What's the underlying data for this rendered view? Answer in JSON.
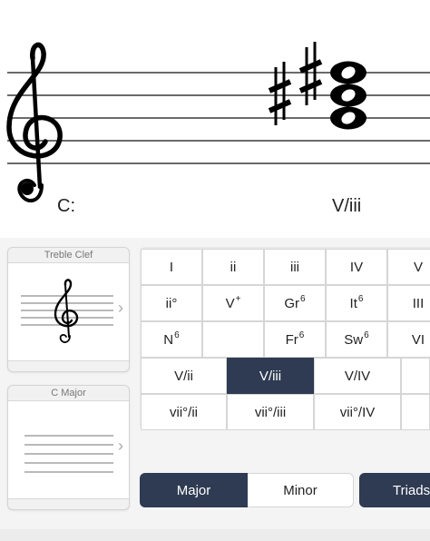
{
  "staff": {
    "key_label": "C:",
    "chord_label": "V/iii"
  },
  "selectors": {
    "clef": {
      "title": "Treble Clef"
    },
    "key": {
      "title": "C Major"
    }
  },
  "chord_rows": [
    [
      "I",
      "ii",
      "iii",
      "IV",
      "V"
    ],
    [
      "ii°",
      "V+",
      "Gr6",
      "It6",
      "III"
    ],
    [
      "N6",
      "",
      "Fr6",
      "Sw6",
      "VI"
    ]
  ],
  "secondary_rows": [
    [
      "V/ii",
      "V/iii",
      "V/IV"
    ],
    [
      "vii°/ii",
      "vii°/iii",
      "vii°/IV"
    ]
  ],
  "selected_chord": "V/iii",
  "mode": {
    "major": "Major",
    "minor": "Minor",
    "selected": "Major"
  },
  "voicing": {
    "triads": "Triads"
  },
  "colors": {
    "accent": "#2e3b52",
    "background": "#f4f4f4"
  }
}
